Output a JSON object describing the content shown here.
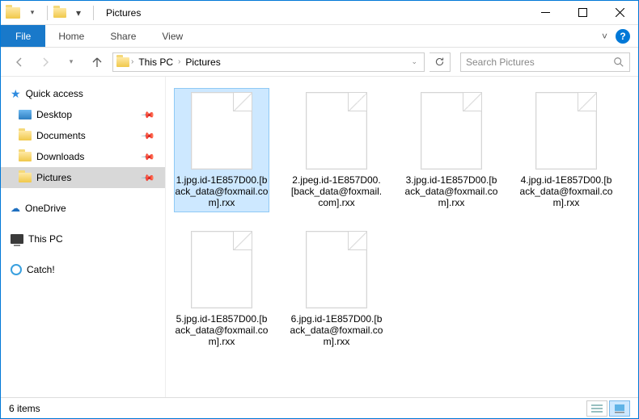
{
  "window": {
    "title": "Pictures"
  },
  "ribbon": {
    "file": "File",
    "tabs": [
      "Home",
      "Share",
      "View"
    ]
  },
  "breadcrumb": {
    "root": "This PC",
    "current": "Pictures"
  },
  "search": {
    "placeholder": "Search Pictures"
  },
  "sidebar": {
    "quick_access": "Quick access",
    "pinned": [
      {
        "label": "Desktop"
      },
      {
        "label": "Documents"
      },
      {
        "label": "Downloads"
      },
      {
        "label": "Pictures"
      }
    ],
    "onedrive": "OneDrive",
    "thispc": "This PC",
    "catch": "Catch!"
  },
  "files": [
    {
      "name": "1.jpg.id-1E857D00.[back_data@foxmail.com].rxx"
    },
    {
      "name": "2.jpeg.id-1E857D00.[back_data@foxmail.com].rxx"
    },
    {
      "name": "3.jpg.id-1E857D00.[back_data@foxmail.com].rxx"
    },
    {
      "name": "4.jpg.id-1E857D00.[back_data@foxmail.com].rxx"
    },
    {
      "name": "5.jpg.id-1E857D00.[back_data@foxmail.com].rxx"
    },
    {
      "name": "6.jpg.id-1E857D00.[back_data@foxmail.com].rxx"
    }
  ],
  "status": {
    "count": "6 items"
  }
}
